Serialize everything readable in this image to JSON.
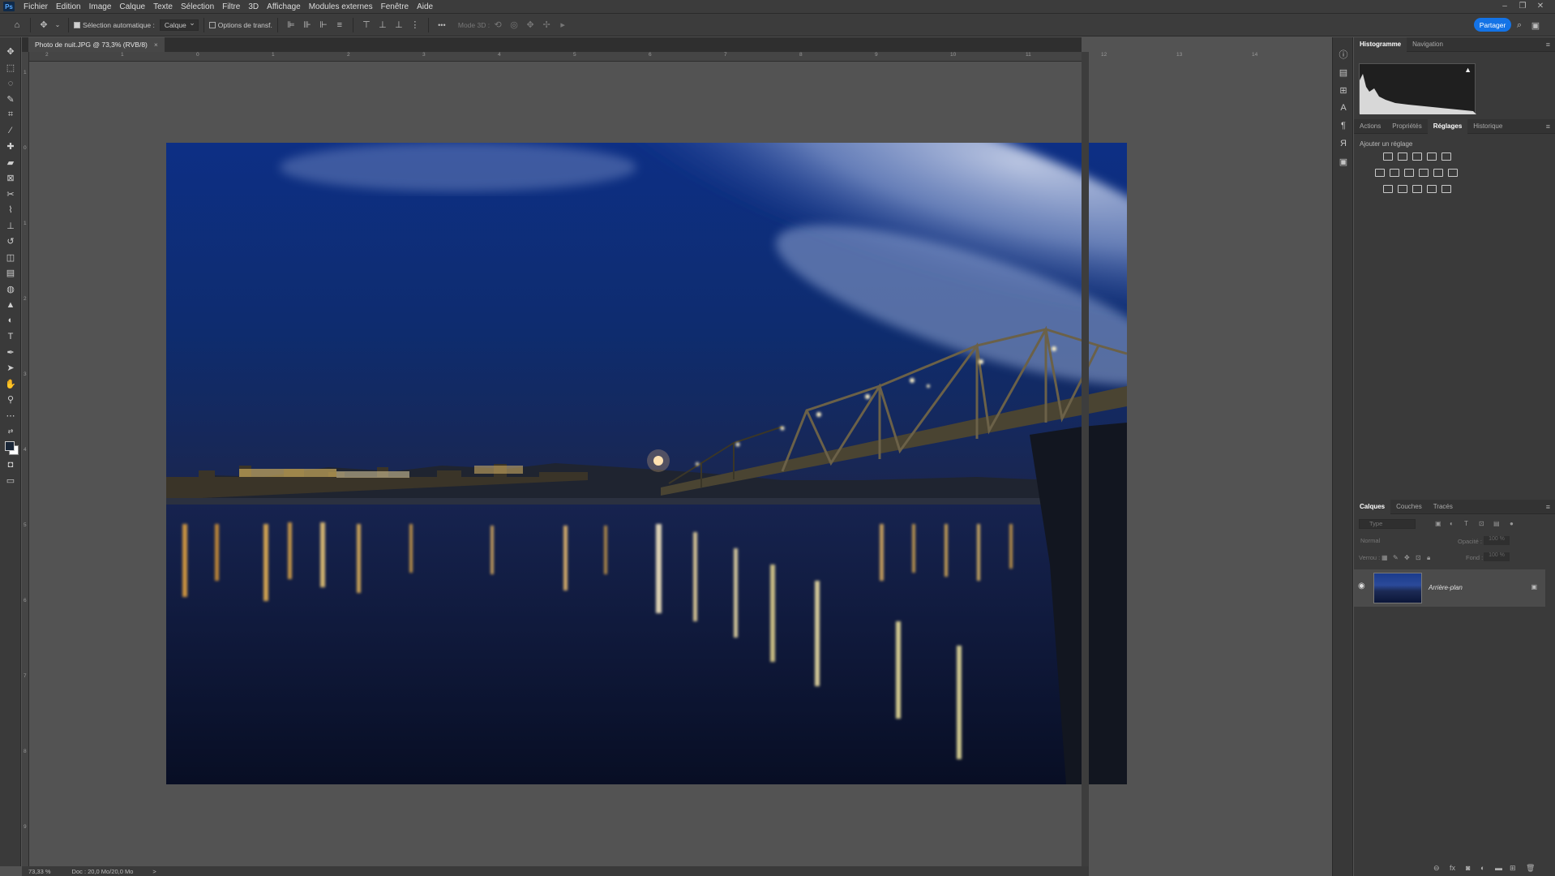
{
  "menu": {
    "app_icon": "Ps",
    "items": [
      "Fichier",
      "Edition",
      "Image",
      "Calque",
      "Texte",
      "Sélection",
      "Filtre",
      "3D",
      "Affichage",
      "Modules externes",
      "Fenêtre",
      "Aide"
    ],
    "window_controls": [
      "–",
      "❐",
      "✕"
    ]
  },
  "options": {
    "auto_select_label": "Sélection automatique :",
    "auto_select_checked": true,
    "target_value": "Calque",
    "transform_label": "Options de transf.",
    "transform_checked": false,
    "more_label": "•••",
    "mode3d_label": "Mode 3D :",
    "share_label": "Partager"
  },
  "document": {
    "tab_title": "Photo de nuit.JPG @ 73,3% (RVB/8)",
    "close_glyph": "×"
  },
  "rulers": {
    "top": [
      "2",
      "1",
      "0",
      "1",
      "2",
      "3",
      "4",
      "5",
      "6",
      "7",
      "8",
      "9",
      "10",
      "11",
      "12",
      "13",
      "14"
    ],
    "left": [
      "1",
      "0",
      "1",
      "2",
      "3",
      "4",
      "5",
      "6",
      "7",
      "8",
      "9"
    ]
  },
  "status": {
    "zoom": "73,33 %",
    "doc_info": "Doc : 20,0 Mo/20,0 Mo",
    "arrow": ">"
  },
  "panels": {
    "top_tabs": [
      "Histogramme",
      "Navigation"
    ],
    "top_active": "Histogramme",
    "mid_tabs": [
      "Actions",
      "Propriétés",
      "Réglages",
      "Historique"
    ],
    "mid_active": "Réglages",
    "adjust_title": "Ajouter un réglage",
    "layers_tabs": [
      "Calques",
      "Couches",
      "Tracés"
    ],
    "layers_active": "Calques",
    "filter_placeholder": "Type",
    "blend_mode": "Normal",
    "opacity_label": "Opacité :",
    "opacity_value": "100 %",
    "lock_label": "Verrou :",
    "fill_label": "Fond :",
    "fill_value": "100 %",
    "layer_name": "Arrière-plan"
  },
  "colors": {
    "accent": "#1473e6",
    "panel_bg": "#3a3a3a",
    "canvas_bg": "#535353",
    "sky_top": "#0b2c7a",
    "water": "#0b1638"
  }
}
